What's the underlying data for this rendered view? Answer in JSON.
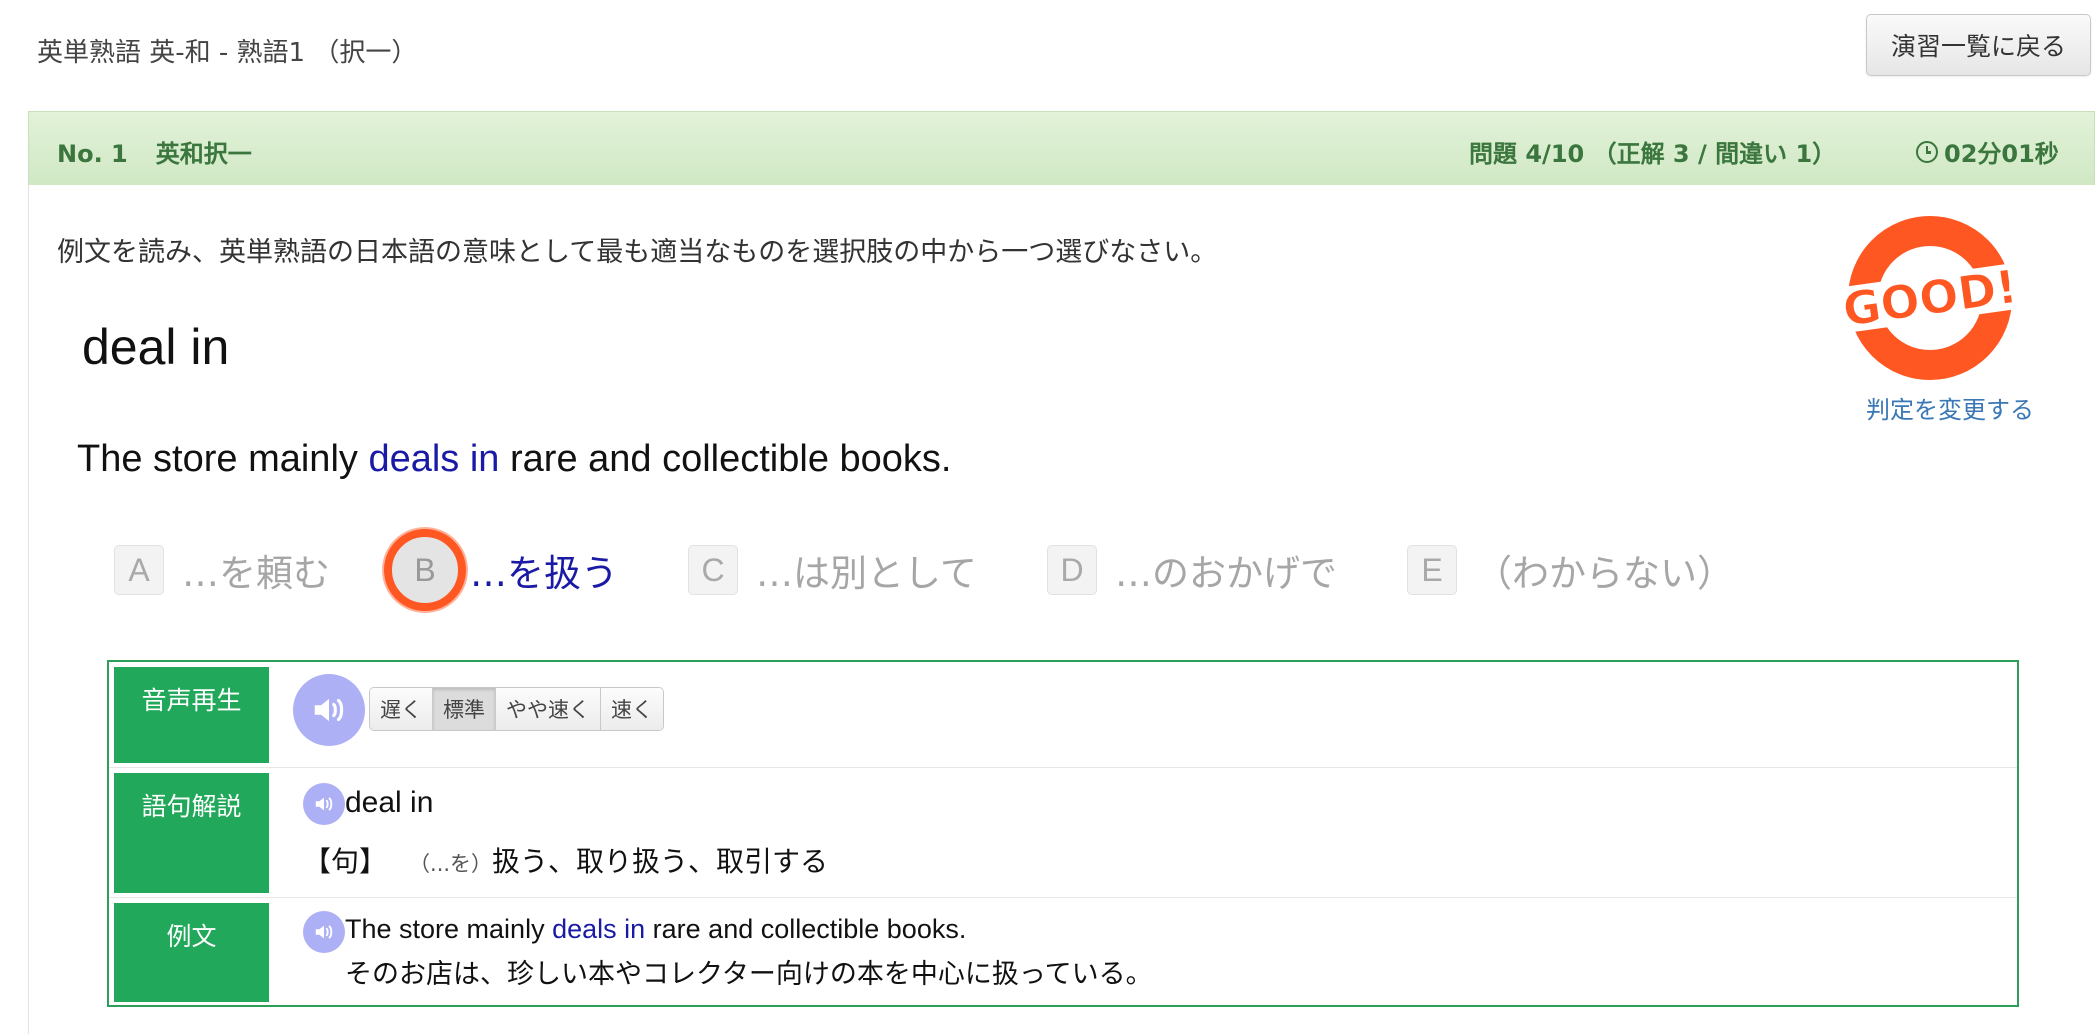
{
  "page": {
    "title": "英単熟語 英-和 - 熟語1 （択一）",
    "back_button": "演習一覧に戻る"
  },
  "header": {
    "no": "No. 1",
    "mode": "英和択一",
    "progress": "問題 4/10 （正解 3 / 間違い 1）",
    "timer": "02分01秒",
    "background_color": "#d5ebc9",
    "text_color": "#3a763d"
  },
  "question": {
    "instruction": "例文を読み、英単熟語の日本語の意味として最も適当なものを選択肢の中から一つ選びなさい。",
    "phrase": "deal in",
    "sentence": {
      "before": "The store mainly ",
      "highlight": "deals in",
      "after": " rare and collectible books."
    }
  },
  "judgment": {
    "stamp_text": "GOOD!",
    "stamp_color": "#ff5722",
    "change_link": "判定を変更する"
  },
  "options": [
    {
      "letter": "A",
      "text": "…を頼む",
      "selected": false
    },
    {
      "letter": "B",
      "text": "…を扱う",
      "selected": true
    },
    {
      "letter": "C",
      "text": "…は別として",
      "selected": false
    },
    {
      "letter": "D",
      "text": "…のおかげで",
      "selected": false
    },
    {
      "letter": "E",
      "text": "（わからない）",
      "selected": false
    }
  ],
  "detail": {
    "audio": {
      "label": "音声再生",
      "speeds": [
        "遅く",
        "標準",
        "やや速く",
        "速く"
      ],
      "active_speed": "標準"
    },
    "vocab": {
      "label": "語句解説",
      "word": "deal in",
      "pos": "【句】",
      "note": "（...を）",
      "meaning": "扱う、取り扱う、取引する"
    },
    "example": {
      "label": "例文",
      "en_before": "The store mainly ",
      "en_highlight": "deals in",
      "en_after": " rare and collectible books.",
      "ja": "そのお店は、珍しい本やコレクター向けの本を中心に扱っている。"
    },
    "accent_color": "#22a85a",
    "speaker_color": "#aeb0f6"
  }
}
